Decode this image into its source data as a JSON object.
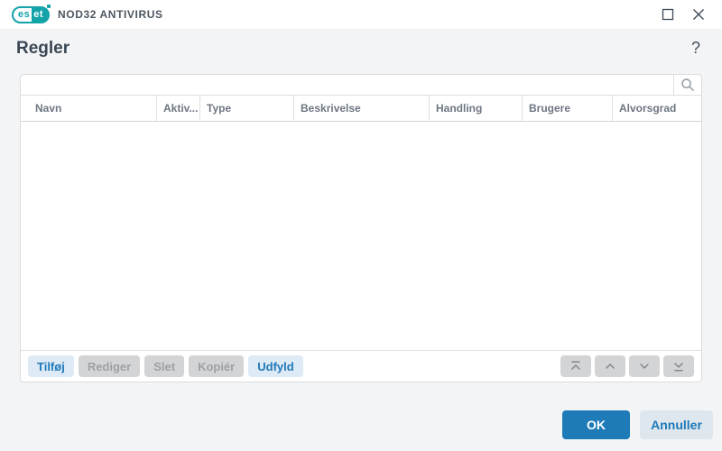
{
  "titlebar": {
    "brand": {
      "left": "es",
      "right": "et"
    },
    "app_title": "NOD32 ANTIVIRUS"
  },
  "page": {
    "title": "Regler",
    "help_label": "?"
  },
  "search": {
    "value": "",
    "placeholder": ""
  },
  "table": {
    "columns": [
      {
        "label": "Navn"
      },
      {
        "label": "Aktiv..."
      },
      {
        "label": "Type"
      },
      {
        "label": "Beskrivelse"
      },
      {
        "label": "Handling"
      },
      {
        "label": "Brugere"
      },
      {
        "label": "Alvorsgrad"
      }
    ],
    "rows": []
  },
  "footer": {
    "buttons": [
      {
        "label": "Tilføj",
        "enabled": true
      },
      {
        "label": "Rediger",
        "enabled": false
      },
      {
        "label": "Slet",
        "enabled": false
      },
      {
        "label": "Kopiér",
        "enabled": false
      },
      {
        "label": "Udfyld",
        "enabled": true
      }
    ],
    "move_buttons": [
      "move-to-top",
      "move-up",
      "move-down",
      "move-to-bottom"
    ]
  },
  "dialog": {
    "ok_label": "OK",
    "cancel_label": "Annuller"
  },
  "colors": {
    "accent_blue": "#1E7BB8",
    "eset_teal": "#12A3A9",
    "enabled_button_bg": "#DEEAF5",
    "disabled_button_bg": "#D3D4D5",
    "cancel_button_bg": "#DEE7EE",
    "page_bg": "#F3F4F6",
    "panel_border": "#DBDCDE",
    "header_text": "#6E7682"
  }
}
